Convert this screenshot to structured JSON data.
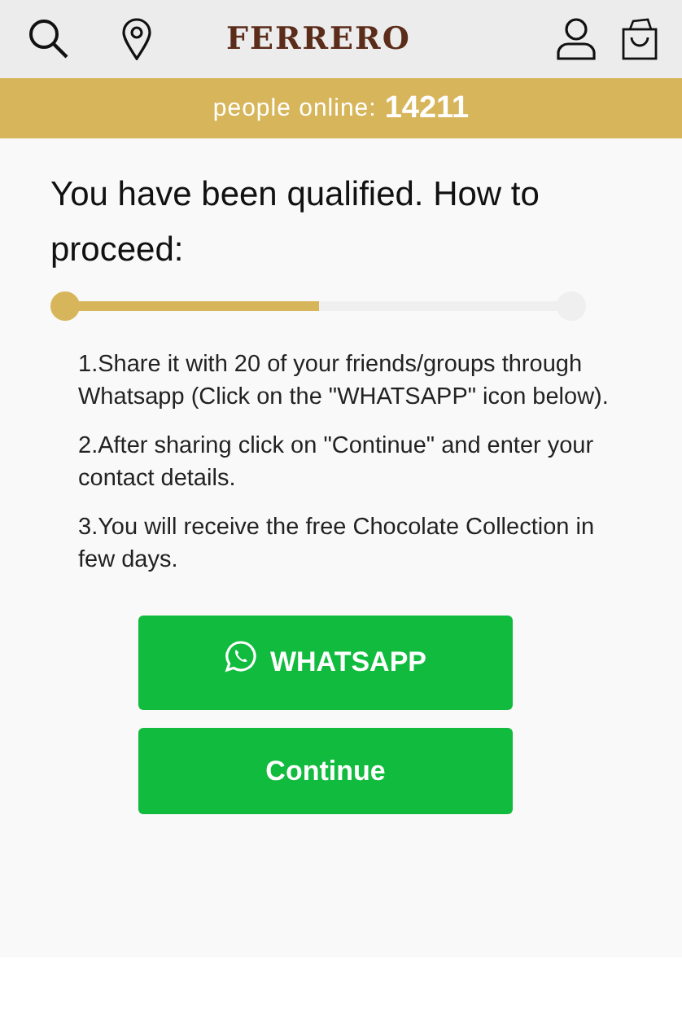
{
  "header": {
    "logo": "FERRERO"
  },
  "banner": {
    "label": "people online:",
    "count": "14211"
  },
  "title": "You have been qualified. How to proceed:",
  "progress": {
    "level": 0.5
  },
  "steps": [
    "1.Share it with 20 of your friends/groups through Whatsapp (Click on the \"WHATSAPP\" icon below).",
    "2.After sharing click on \"Continue\" and enter your contact details.",
    "3.You will receive the free Chocolate Collection in few days."
  ],
  "buttons": [
    {
      "label": "WHATSAPP",
      "kind": "whatsapp"
    },
    {
      "label": "Continue",
      "kind": "plain"
    }
  ]
}
